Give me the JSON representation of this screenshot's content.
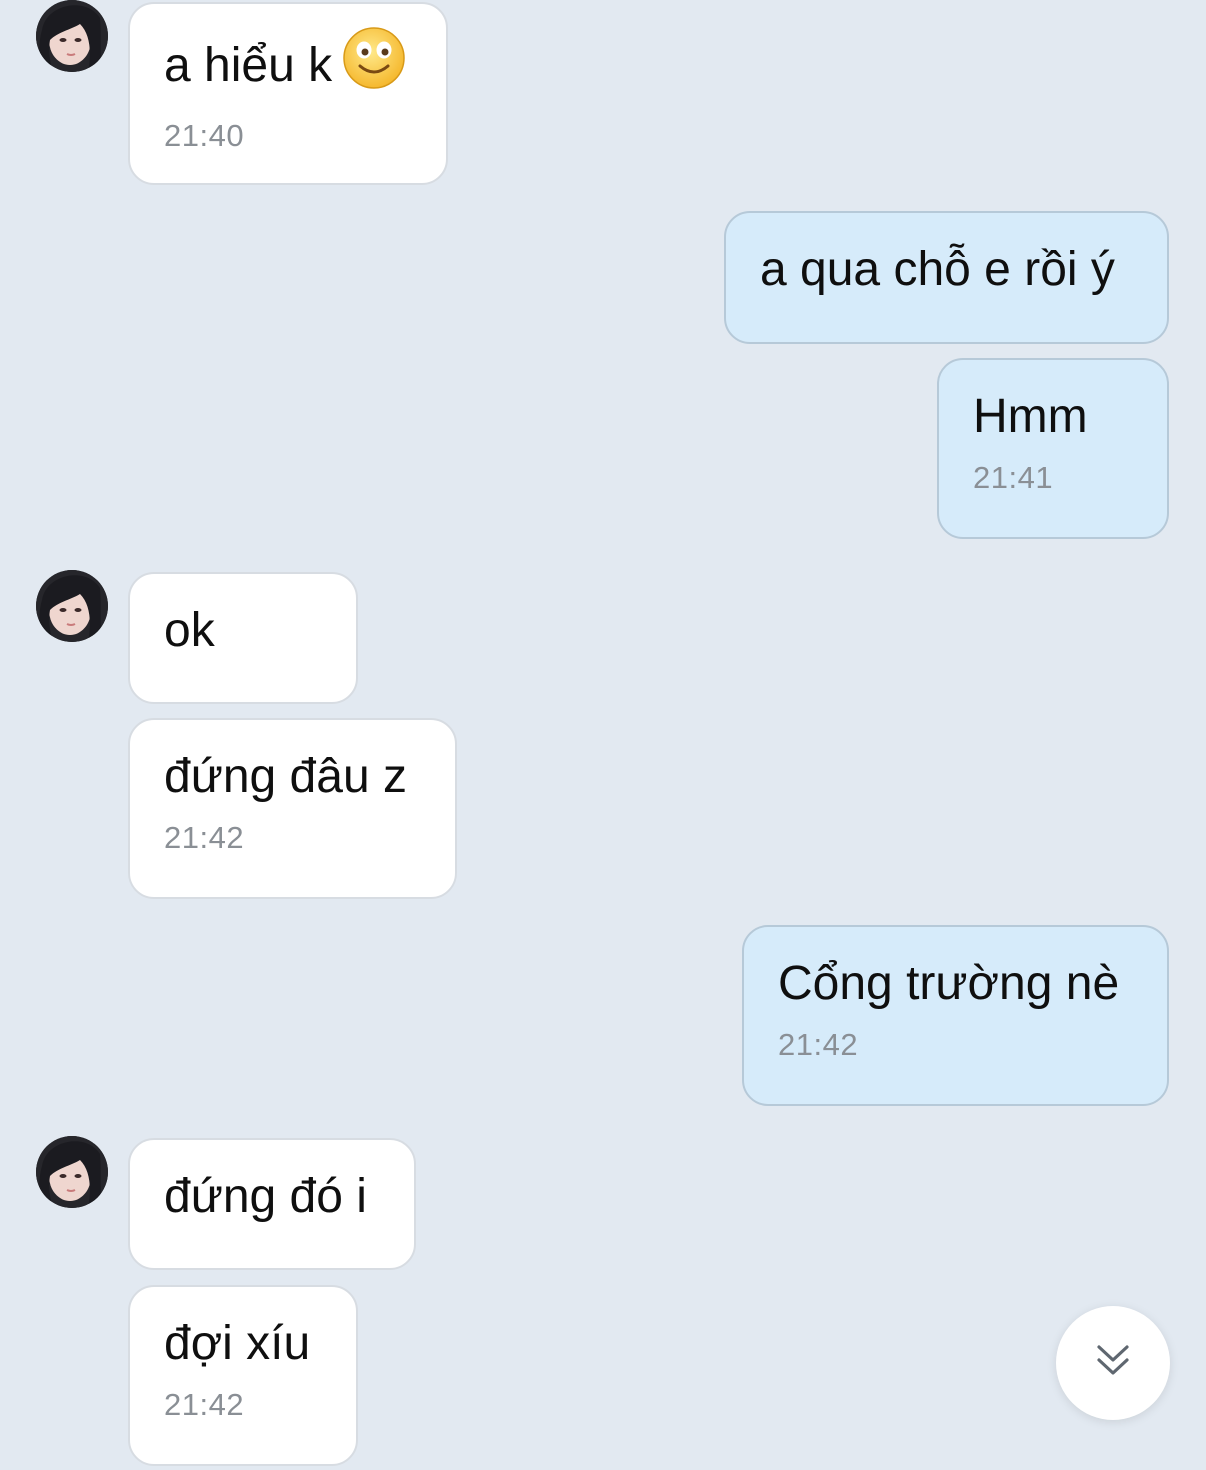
{
  "messages": [
    {
      "side": "in",
      "text": "a hiểu k",
      "emoji": "smiling-face-icon",
      "time": "21:40"
    },
    {
      "side": "out",
      "text": "a qua chỗ e rồi ý",
      "time": ""
    },
    {
      "side": "out",
      "text": "Hmm",
      "time": "21:41"
    },
    {
      "side": "in",
      "text": "ok",
      "time": ""
    },
    {
      "side": "in",
      "text": "đứng đâu z",
      "time": "21:42"
    },
    {
      "side": "out",
      "text": "Cổng trường nè",
      "time": "21:42"
    },
    {
      "side": "in",
      "text": "đứng đó i",
      "time": ""
    },
    {
      "side": "in",
      "text": "đợi xíu",
      "time": "21:42"
    }
  ],
  "scroll_button": {
    "icon": "double-chevron-down-icon"
  },
  "colors": {
    "background": "#e2e9f1",
    "incoming_bubble": "#ffffff",
    "outgoing_bubble": "#d6ebfa",
    "timestamp": "#8a8f95"
  }
}
